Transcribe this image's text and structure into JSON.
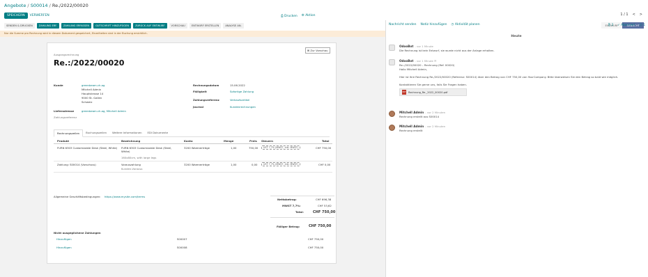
{
  "breadcrumb": [
    "Angebote",
    "S00014",
    "Re./2022/00020"
  ],
  "buttons": {
    "save": "SPEICHERN",
    "discard": "VERWERFEN"
  },
  "center_actions": [
    "⎙ Drucken",
    "⚙ Aktion"
  ],
  "pager": {
    "text": "1 / 1",
    "prev": "<",
    "next": ">"
  },
  "action_buttons": [
    {
      "label": "SENDEN & DRUCKEN",
      "style": "light"
    },
    {
      "label": "ZAHLUNG ERF.",
      "style": "dark"
    },
    {
      "label": "ZAHLUNG ERFASSEN",
      "style": "dark"
    },
    {
      "label": "GUTSCHRIFT HINZUFÜGEN",
      "style": "dark"
    },
    {
      "label": "ZURÜCK AUF ENTWURF",
      "style": "dark"
    },
    {
      "label": "VORSCHAU",
      "style": "light"
    },
    {
      "label": "ENTWURF ERSTELLEN",
      "style": "light"
    },
    {
      "label": "ANALYSE AN.",
      "style": "light"
    }
  ],
  "status": [
    "ENTWURF",
    "GEBUCHT"
  ],
  "alert": "Nur die Summe pro Rechnung wird in diesem Dokument gespeichert, Einzelheiten sind in der Buchung ersichtlich.",
  "chatter": {
    "send_message": "Nachricht senden",
    "log_note": "Notiz hinzufügen",
    "activity": "◷ Aktivität planen",
    "attachments": "⎘ 2",
    "follow": "✓ Abonniert",
    "followers": "☺ 1",
    "today": "Heute",
    "messages": [
      {
        "author": "OdooBot",
        "time": "- vor 1 Minute",
        "lines": [
          "Die Rechnung ist kein Entwurf, sie wurde nicht aus der Anlage erhalten."
        ],
        "avatar": "bot"
      },
      {
        "author": "OdooBot",
        "time": "- vor 1 Minute ✉",
        "lines": [
          "Re.:/2022/00020 – Rechnung (Ref. 00020)",
          "Hallo Mitchell Admin,",
          "Hier ist Ihre Rechnung Re./2022/00020 (Referenz: S00014) über den Betrag von CHF 750,00 von YourCompany. Bitte überweisen Sie den Betrag so bald wie möglich.",
          "Kontaktieren Sie gerne uns, falls Sie Fragen haben."
        ],
        "avatar": "bot",
        "attachment": "Rechnung_Re._2022_00020.pdf"
      },
      {
        "author": "Mitchell Admin",
        "time": "- vor 2 Minuten",
        "lines": [
          "Rechnung erstellt aus S00014"
        ],
        "avatar": "img"
      },
      {
        "author": "Mitchell Admin",
        "time": "- vor 2 Minuten",
        "lines": [
          "Rechnung erstellt"
        ],
        "avatar": "img"
      }
    ]
  },
  "sheet": {
    "preview_label": "⊞ Zur Vorschau",
    "doc_type": "Ausgangsrechnung",
    "title": "Re.:/2022/00020",
    "customer_label": "Kunde",
    "customer_lines": [
      "greenbeam.ch.ag",
      "Mitchell Admin",
      "Hauptstrasse 14",
      "9000 St. Gallen",
      "Schweiz"
    ],
    "delivery_label": "Lieferadresse",
    "delivery_value": "greenbeam.ch.ag, Mitchell Admin",
    "payment_ref": "Zahlungsreferenz",
    "right_fields": [
      {
        "label": "Rechnungsdatum",
        "value": "15.06.2022",
        "link": false
      },
      {
        "label": "Fälligkeit",
        "value": "Sofortige Zahlung",
        "link": true
      },
      {
        "label": "Zahlungsreferenz",
        "value": "Verkaufsartikel",
        "link": true
      },
      {
        "label": "Journal",
        "value": "Kundenrechnungen",
        "link": true
      }
    ],
    "tabs": [
      "Rechnungszeilen",
      "Buchungszeilen",
      "Weitere Informationen",
      "EDI Dokumente"
    ],
    "columns": [
      "Produkt",
      "Bezeichnung",
      "Konto",
      "Menge",
      "Preis",
      "Steuern",
      "Total"
    ],
    "rows": [
      {
        "product": "FURN 6303 Customizable Desk (Steel, White)",
        "desc": [
          "FURN 6303 Customizable Desk (Steel, White)",
          "160x80cm, with large legs"
        ],
        "account": "3200 Warenerträge",
        "qty": "1,00",
        "price": "750,00",
        "tax": "UST 7,7% (MWST, inkl. MWST)",
        "total": "CHF 750,00"
      },
      {
        "product": "Zahlung: S00014 (Vorschuss)",
        "desc": [
          "Vorauszahlung",
          "Kunden-Vorausz."
        ],
        "account": "3200 Warenerträge",
        "qty": "1,00",
        "price": "0,00",
        "tax": "UST 7,7% (MWST, inkl. MWST)",
        "total": "CHF 0,00"
      }
    ],
    "terms_prefix": "Allgemeine Geschäftsbedingungen:",
    "terms_link": "https://www.mysite.com/terms",
    "totals": [
      {
        "label": "Nettobetrag:",
        "value": "CHF 696,38"
      },
      {
        "label": "MWST 7,7%:",
        "value": "CHF 53,62"
      },
      {
        "label": "Total:",
        "value": "CHF 750,00"
      }
    ],
    "due_label": "Fälliger Betrag:",
    "due_value": "CHF 750,00",
    "payments_title": "Nicht ausgeglichene Zahlungen",
    "payments": [
      {
        "link": "Hinzufügen",
        "ref": "S00007",
        "amount": "CHF 750,00"
      },
      {
        "link": "Hinzufügen",
        "ref": "S00008",
        "amount": "CHF 750,00"
      }
    ]
  }
}
